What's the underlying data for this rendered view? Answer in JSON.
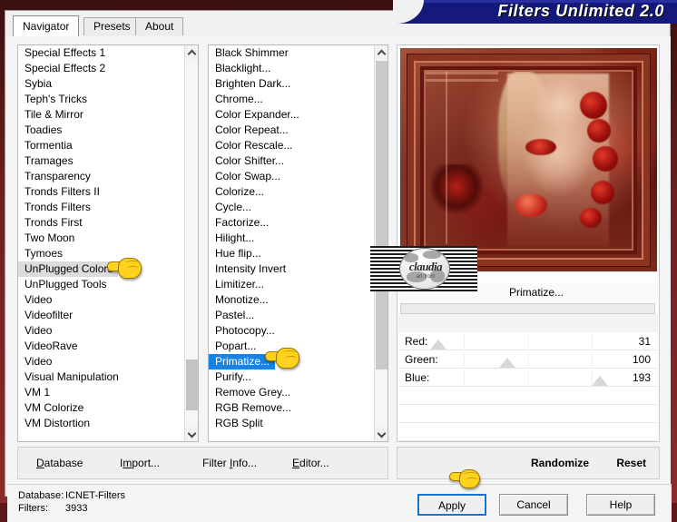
{
  "window": {
    "title": "Filters Unlimited 2.0"
  },
  "tabs": [
    {
      "label": "Navigator",
      "active": true
    },
    {
      "label": "Presets",
      "active": false
    },
    {
      "label": "About",
      "active": false
    }
  ],
  "category_list": {
    "items": [
      "Special Effects 1",
      "Special Effects 2",
      "Sybia",
      "Teph's Tricks",
      "Tile & Mirror",
      "Toadies",
      "Tormentia",
      "Tramages",
      "Transparency",
      "Tronds Filters II",
      "Tronds Filters",
      "Tronds First",
      "Two Moon",
      "Tymoes",
      "UnPlugged Colors",
      "UnPlugged Tools",
      "Video",
      "Videofilter",
      "Video",
      "VideoRave",
      "Video",
      "Visual Manipulation",
      "VM 1",
      "VM Colorize",
      "VM Distortion"
    ],
    "selected": "UnPlugged Colors",
    "selected_index": 14
  },
  "filter_list": {
    "items": [
      "Black Shimmer",
      "Blacklight...",
      "Brighten Dark...",
      "Chrome...",
      "Color Expander...",
      "Color Repeat...",
      "Color Rescale...",
      "Color Shifter...",
      "Color Swap...",
      "Colorize...",
      "Cycle...",
      "Factorize...",
      "Hilight...",
      "Hue flip...",
      "Intensity Invert",
      "Limitizer...",
      "Monotize...",
      "Pastel...",
      "Photocopy...",
      "Popart...",
      "Primatize...",
      "Purify...",
      "Remove Grey...",
      "RGB Remove...",
      "RGB Split"
    ],
    "selected": "Primatize...",
    "selected_index": 20
  },
  "params": {
    "header": "Primatize...",
    "sliders": [
      {
        "label": "Red:",
        "value": "31",
        "percent": 12
      },
      {
        "label": "Green:",
        "value": "100",
        "percent": 39
      },
      {
        "label": "Blue:",
        "value": "193",
        "percent": 75
      }
    ],
    "empty_rows": 4
  },
  "watermark": {
    "text": "claudia",
    "subtext": "art from"
  },
  "commands": {
    "database": "Database",
    "import": "Import...",
    "filter_info": "Filter Info...",
    "editor": "Editor...",
    "randomize": "Randomize",
    "reset": "Reset"
  },
  "status": {
    "database_label": "Database:",
    "database_value": "ICNET-Filters",
    "filters_label": "Filters:",
    "filters_value": "3933"
  },
  "buttons": {
    "apply": "Apply",
    "cancel": "Cancel",
    "help": "Help"
  },
  "colors": {
    "titlebar": "#151a7a",
    "selection_blue": "#1683e8",
    "selection_gray": "#dcdcdc",
    "apply_focus": "#1472d6",
    "frame_red": "#8b2b2b"
  }
}
